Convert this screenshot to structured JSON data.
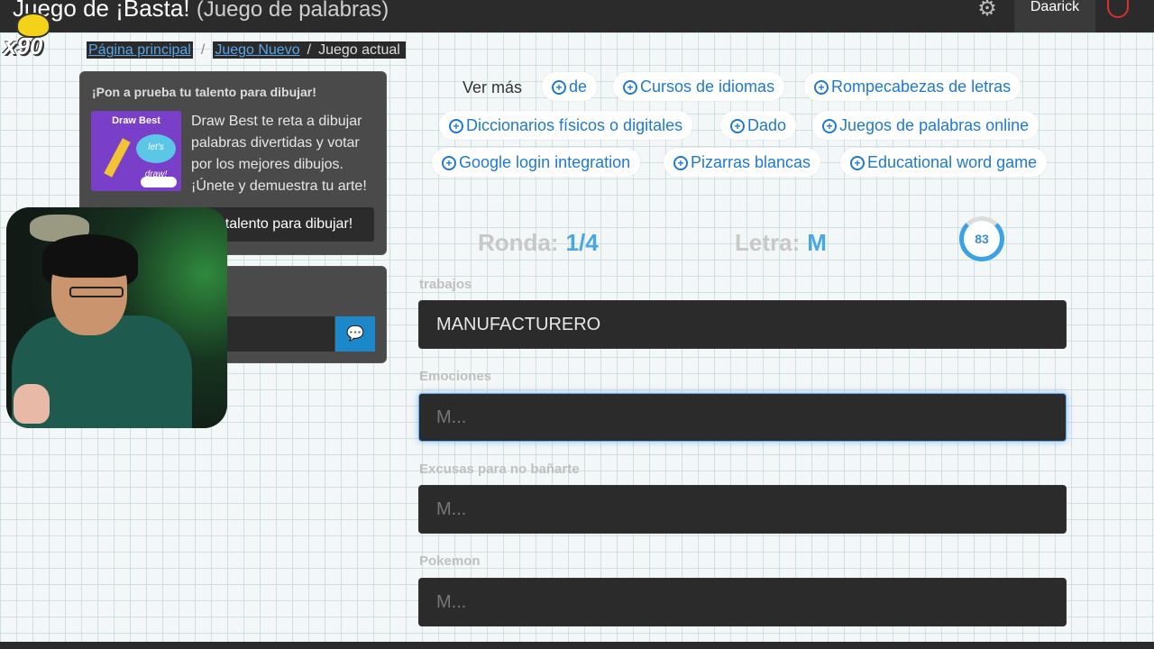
{
  "header": {
    "title": "Juego de ¡Basta!",
    "subtitle": "(Juego de palabras)",
    "username": "Daarick"
  },
  "overlay": {
    "multiplier": "x90"
  },
  "breadcrumb": {
    "home": "Página principal",
    "new_game": "Juego Nuevo",
    "current": "Juego actual",
    "separator": "/"
  },
  "promo": {
    "title": "¡Pon a prueba tu talento para dibujar!",
    "thumb_title": "Draw Best",
    "thumb_bubble": "let's draw!",
    "description": "Draw Best te reta a dibujar palabras divertidas y votar por los mejores dibujos. ¡Únete y demuestra tu arte!",
    "button_label": "talento para dibujar!"
  },
  "tags": {
    "label": "Ver más",
    "items": [
      "de",
      "Cursos de idiomas",
      "Rompecabezas de letras",
      "Diccionarios físicos o digitales",
      "Dado",
      "Juegos de palabras online",
      "Google login integration",
      "Pizarras blancas",
      "Educational word game"
    ]
  },
  "game": {
    "round_label": "Ronda:",
    "round_value": "1/4",
    "letter_label": "Letra:",
    "letter_value": "M",
    "timer": "83",
    "categories": [
      {
        "label": "trabajos",
        "value": "MANUFACTURERO",
        "placeholder": "M..."
      },
      {
        "label": "Emociones",
        "value": "",
        "placeholder": "M..."
      },
      {
        "label": "Excusas para no bañarte",
        "value": "",
        "placeholder": "M..."
      },
      {
        "label": "Pokemon",
        "value": "",
        "placeholder": "M..."
      }
    ]
  },
  "icons": {
    "settings": "gear-icon",
    "power": "power-icon",
    "tag": "plus-circle-icon",
    "chat_send": "chat-bubble-icon"
  },
  "colors": {
    "accent": "#1e7ad1",
    "topbar": "#2b2b2b",
    "input_bg": "#2b2b2b",
    "power": "#d9302e"
  }
}
